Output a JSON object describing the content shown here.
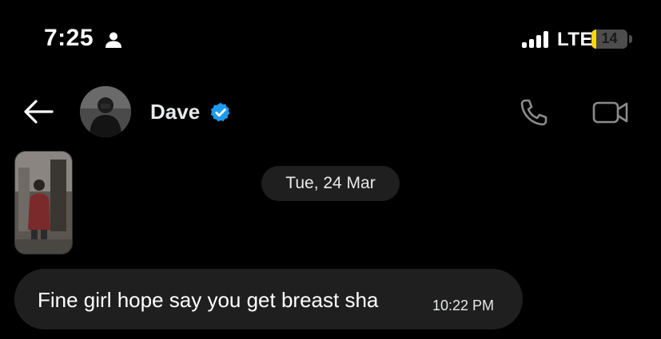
{
  "status_bar": {
    "time": "7:25",
    "network": "LTE",
    "battery_level": "14",
    "battery_fraction": 0.14,
    "signal_bars": 4,
    "battery_color": "#ffd60a",
    "person_icon": "person-icon"
  },
  "header": {
    "back_icon": "back-arrow-icon",
    "contact_name": "Dave",
    "verified_color": "#1d9bf0",
    "call_icon": "phone-icon",
    "video_icon": "video-camera-icon"
  },
  "conversation": {
    "date_separator": "Tue, 24 Mar",
    "messages": [
      {
        "text": "Fine girl hope say you get breast sha",
        "time": "10:22 PM"
      }
    ]
  },
  "colors": {
    "background": "#000000",
    "bubble": "#1f1f1f",
    "icon_gray": "#8b8b8b"
  }
}
